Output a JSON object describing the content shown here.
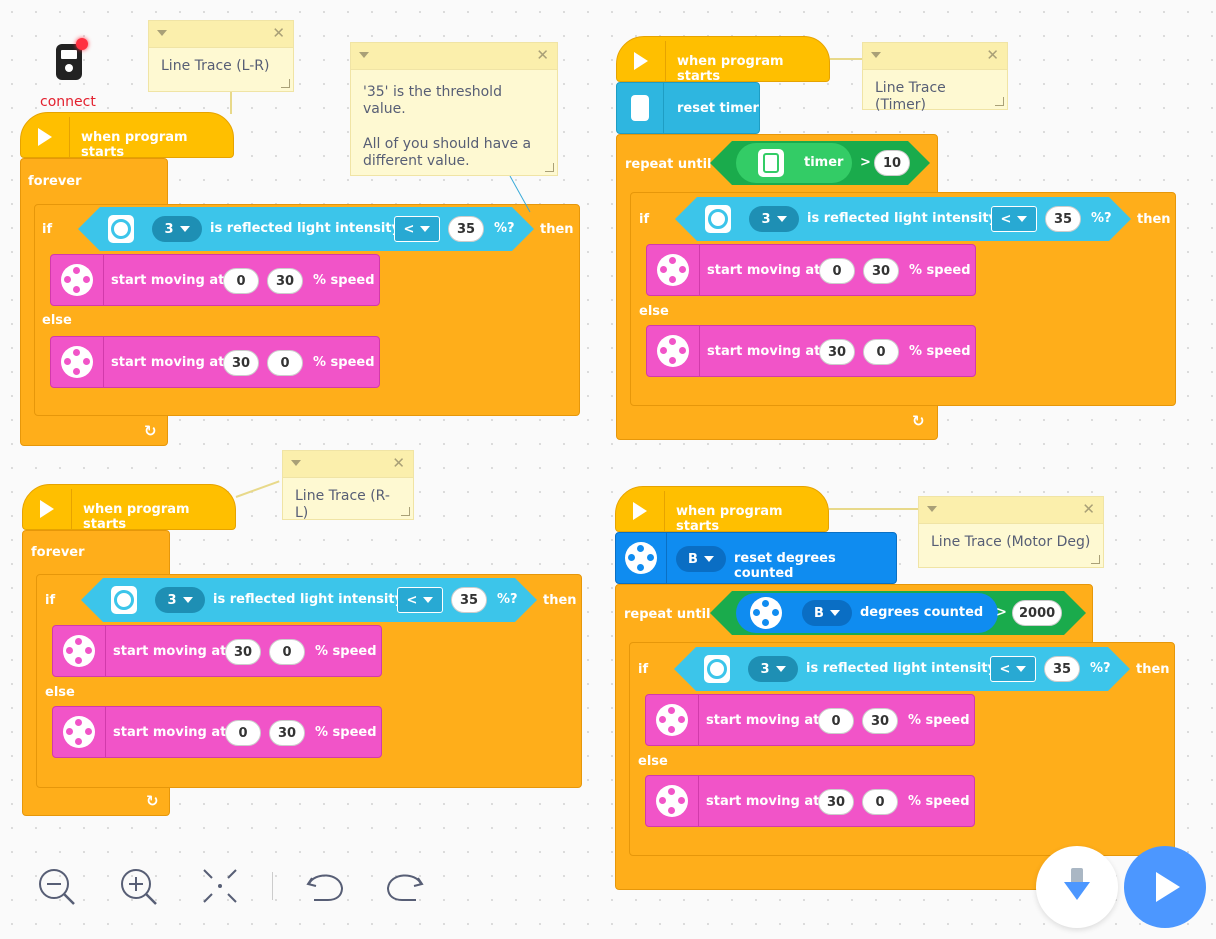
{
  "connect": {
    "label": "connect"
  },
  "comments": {
    "lr": "Line Trace (L-R)",
    "threshold_line1": "'35' is the threshold value.",
    "threshold_line2": "All of you should have a",
    "threshold_line3": "different value.",
    "timer": "Line Trace (Timer)",
    "rl": "Line Trace (R-L)",
    "motor_deg": "Line Trace (Motor Deg)"
  },
  "blocks": {
    "when_program_starts": "when program starts",
    "forever": "forever",
    "if": "if",
    "then": "then",
    "else": "else",
    "repeat_until": "repeat until",
    "is_reflected": "is reflected light intensity",
    "pct_q": "%?",
    "start_moving_at": "start moving at",
    "pct_speed": "% speed",
    "reset_timer": "reset timer",
    "timer": "timer",
    "reset_degrees": "reset degrees counted",
    "degrees_counted": "degrees counted",
    "gt": ">",
    "lt": "<"
  },
  "values": {
    "port3": "3",
    "portB": "B",
    "threshold": "35",
    "v0": "0",
    "v30": "30",
    "v10": "10",
    "v2000": "2000"
  },
  "colors": {
    "event": "#ffbf00",
    "control": "#ffae1a",
    "sensor": "#3cc5ea",
    "motor": "#f154c8",
    "operator": "#1aab4c",
    "motor_sensor": "#0f8cf0",
    "play": "#4c97ff"
  }
}
